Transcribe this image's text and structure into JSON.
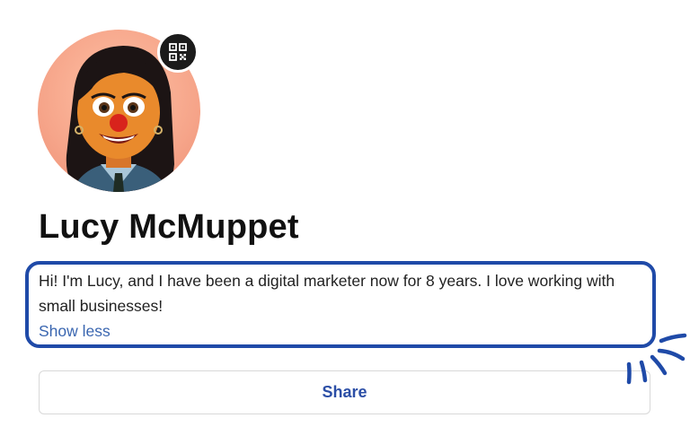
{
  "profile": {
    "name": "Lucy McMuppet",
    "bio": "Hi! I'm Lucy, and I have been a digital marketer now for 8 years. I love working with small businesses!",
    "toggle_label": "Show less"
  },
  "actions": {
    "share_label": "Share"
  },
  "icons": {
    "qr": "qr-code-icon",
    "emphasis": "sparkle-lines-icon"
  },
  "colors": {
    "highlight_border": "#1f4aa8",
    "link": "#3a66b0",
    "share_text": "#2b4ea6",
    "badge_bg": "#1b1b1b"
  }
}
